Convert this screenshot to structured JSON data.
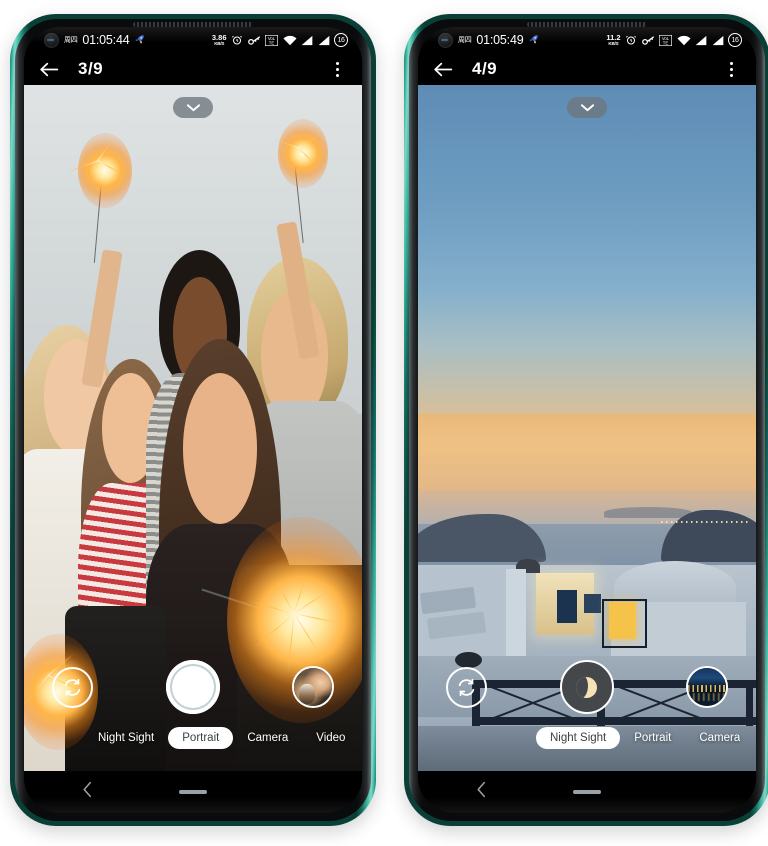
{
  "phones": [
    {
      "id": "left",
      "status_bar": {
        "day": "周四",
        "time": "01:05:44",
        "rocket_icon": "rocket-icon",
        "data_rate_value": "3.86",
        "data_rate_unit": "KB/S",
        "alarm_icon": "alarm-clock-icon",
        "key_icon": "key-icon",
        "volte_icon": "volte-icon",
        "wifi_icon": "wifi-icon",
        "signal_icon_1": "signal-bars-icon",
        "signal_icon_2": "signal-bars-icon",
        "battery_level": "16"
      },
      "app_bar": {
        "back_icon": "back-arrow-icon",
        "counter": "3/9",
        "menu_icon": "overflow-menu-icon"
      },
      "viewfinder": {
        "expand_icon": "chevron-down-icon",
        "photo_description": "group of friends holding sparklers on a beach"
      },
      "controls": {
        "switch_camera_icon": "switch-camera-icon",
        "shutter_icon": "shutter-button",
        "shutter_style": "standard",
        "thumbnail_description": "woman with a dog"
      },
      "modes": [
        {
          "label": "Night Sight",
          "active": false
        },
        {
          "label": "Portrait",
          "active": true
        },
        {
          "label": "Camera",
          "active": false
        },
        {
          "label": "Video",
          "active": false
        }
      ],
      "nav_bar": {
        "back_icon": "nav-back-icon",
        "home_icon": "home-indicator"
      }
    },
    {
      "id": "right",
      "status_bar": {
        "day": "周四",
        "time": "01:05:49",
        "rocket_icon": "rocket-icon",
        "data_rate_value": "11.2",
        "data_rate_unit": "KB/S",
        "alarm_icon": "alarm-clock-icon",
        "key_icon": "key-icon",
        "volte_icon": "volte-icon",
        "wifi_icon": "wifi-icon",
        "signal_icon_1": "signal-bars-icon",
        "signal_icon_2": "signal-bars-icon",
        "battery_level": "16"
      },
      "app_bar": {
        "back_icon": "back-arrow-icon",
        "counter": "4/9",
        "menu_icon": "overflow-menu-icon"
      },
      "viewfinder": {
        "expand_icon": "chevron-down-icon",
        "photo_description": "Santorini sunset over the sea with white cliffside buildings"
      },
      "controls": {
        "switch_camera_icon": "switch-camera-icon",
        "shutter_icon": "moon-icon",
        "shutter_style": "night",
        "thumbnail_description": "night cityscape reflected on water"
      },
      "modes": [
        {
          "label": "Night Sight",
          "active": true
        },
        {
          "label": "Portrait",
          "active": false
        },
        {
          "label": "Camera",
          "active": false
        }
      ],
      "nav_bar": {
        "back_icon": "nav-back-icon",
        "home_icon": "home-indicator"
      }
    }
  ],
  "colors": {
    "frame": "#2aa893",
    "status_bar_bg": "#000000",
    "mode_active_bg": "#ffffff",
    "mode_active_text": "#3c4043",
    "shutter": "#ffffff",
    "night_shutter": "#45484b",
    "moon": "#f4e3b5",
    "page_bg": "#ffffff"
  }
}
